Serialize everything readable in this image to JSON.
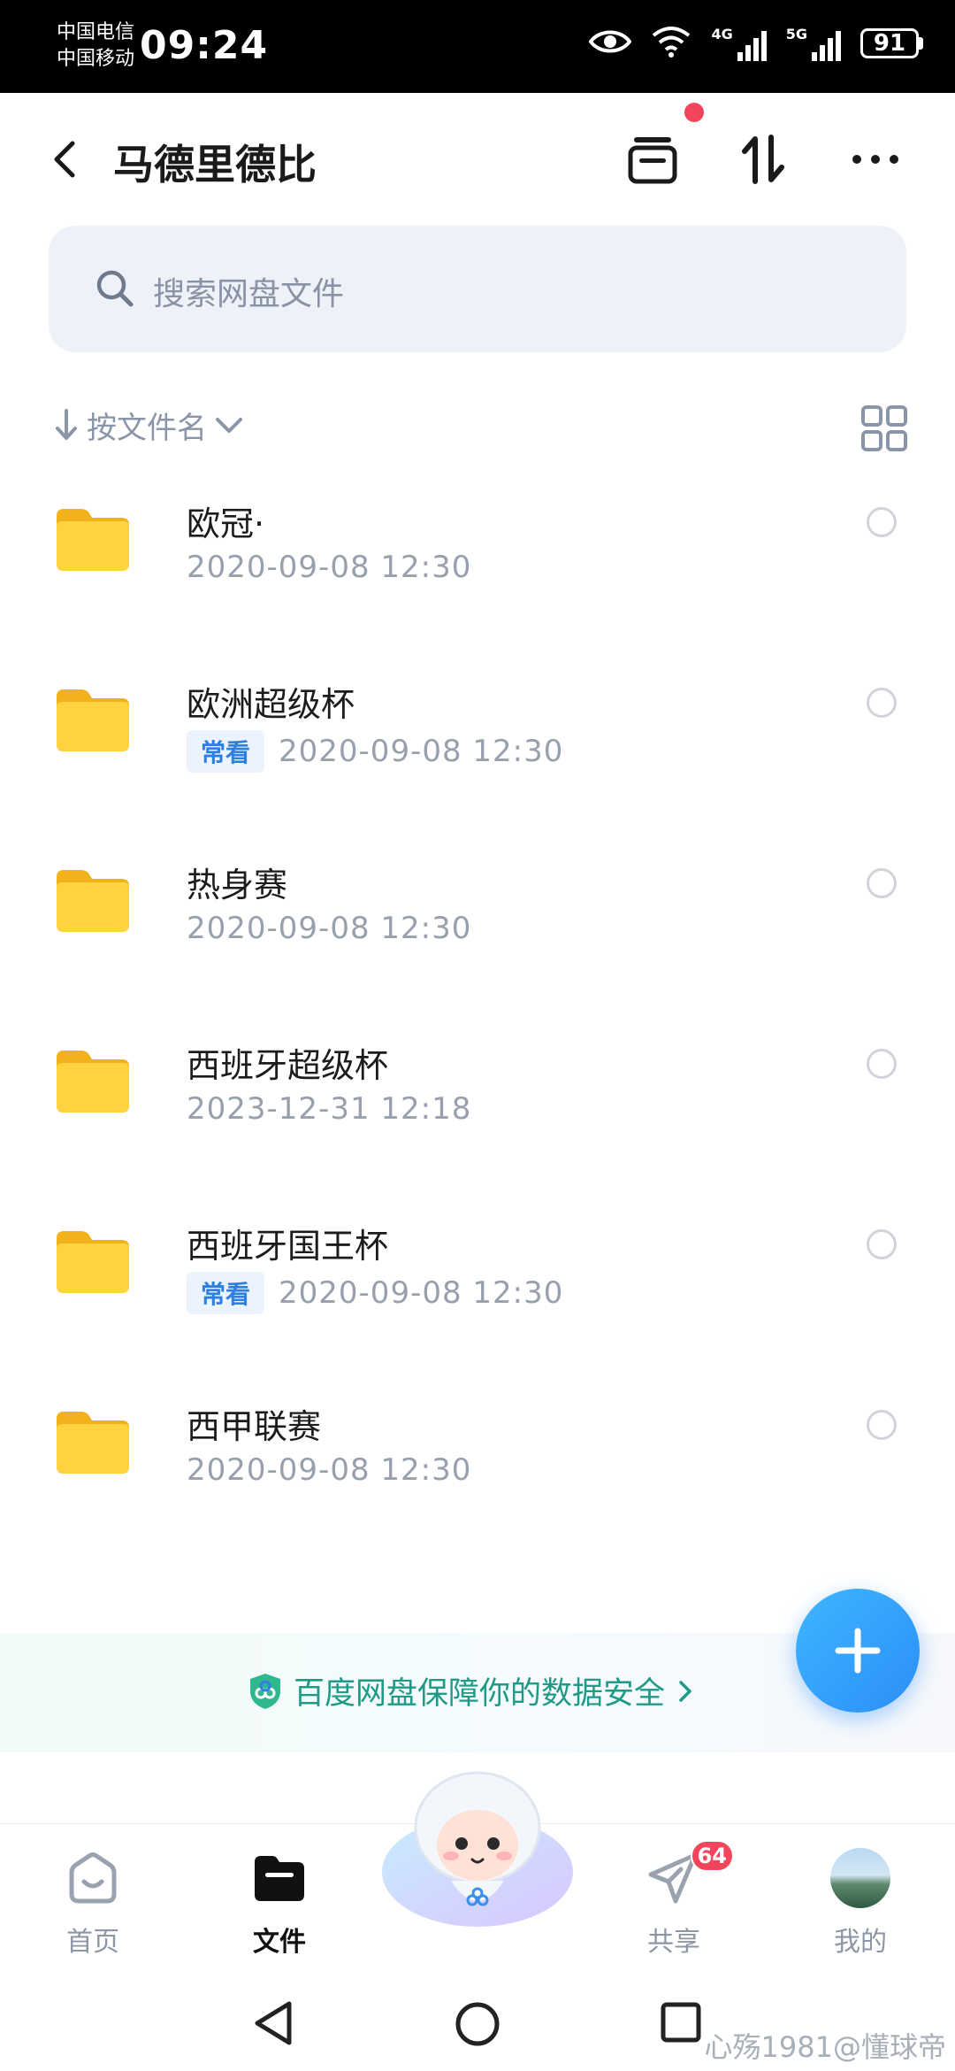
{
  "status_bar": {
    "carrier_1": "中国电信",
    "carrier_2": "中国移动",
    "time": "09:24",
    "signal_1_label": "4G",
    "signal_2_label": "5G",
    "battery": "91"
  },
  "header": {
    "title": "马德里德比"
  },
  "search": {
    "placeholder": "搜索网盘文件"
  },
  "sort": {
    "label": "按文件名"
  },
  "files": [
    {
      "name": "欧冠·",
      "tag": "",
      "date": "2020-09-08  12:30"
    },
    {
      "name": "欧洲超级杯",
      "tag": "常看",
      "date": "2020-09-08  12:30"
    },
    {
      "name": "热身赛",
      "tag": "",
      "date": "2020-09-08  12:30"
    },
    {
      "name": "西班牙超级杯",
      "tag": "",
      "date": "2023-12-31  12:18"
    },
    {
      "name": "西班牙国王杯",
      "tag": "常看",
      "date": "2020-09-08  12:30"
    },
    {
      "name": "西甲联赛",
      "tag": "",
      "date": "2020-09-08  12:30"
    }
  ],
  "banner": {
    "text": "百度网盘保障你的数据安全"
  },
  "bottom_nav": {
    "home": "首页",
    "files": "文件",
    "share": "共享",
    "share_badge": "64",
    "me": "我的"
  },
  "watermark": "心殇1981@懂球帝",
  "colors": {
    "accent": "#2b8ff7",
    "folder": "#ffd23f",
    "badge": "#f2455c",
    "banner_text": "#1f9a86"
  }
}
